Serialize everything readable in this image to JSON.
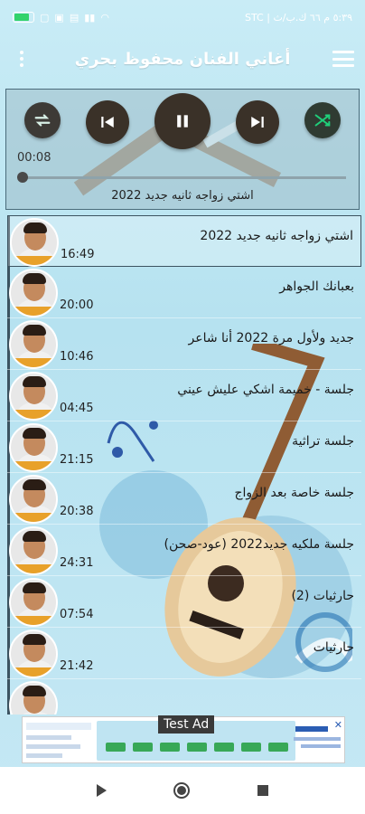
{
  "status_bar": {
    "battery_level": "",
    "right_text": "STC | ٥:٣٩ م ٦٦ ك.ب/ث"
  },
  "app_bar": {
    "title": "أغاني الفنان محفوظ بحري"
  },
  "player": {
    "current_time": "00:08",
    "now_playing": "اشتي زواجه ثانيه جديد 2022",
    "progress_fraction": 0.01,
    "state": "playing"
  },
  "songs": [
    {
      "title": "اشتي زواجه ثانيه جديد 2022",
      "duration": "16:49",
      "active": true
    },
    {
      "title": "بعبانك الجواهر",
      "duration": "20:00",
      "active": false
    },
    {
      "title": "جديد ولأول مرة 2022 أنا شاعر",
      "duration": "10:46",
      "active": false
    },
    {
      "title": "جلسة - خميمة اشكي عليش عيني",
      "duration": "04:45",
      "active": false
    },
    {
      "title": "جلسة تراثية",
      "duration": "21:15",
      "active": false
    },
    {
      "title": "جلسة خاصة بعد الزواج",
      "duration": "20:38",
      "active": false
    },
    {
      "title": "جلسة ملكيه جديد2022 (عود-صحن)",
      "duration": "24:31",
      "active": false
    },
    {
      "title": "حارثيات (2)",
      "duration": "07:54",
      "active": false
    },
    {
      "title": "حارثيات",
      "duration": "21:42",
      "active": false
    },
    {
      "title": "",
      "duration": "",
      "active": false
    }
  ],
  "ad": {
    "label": "Test Ad"
  },
  "colors": {
    "background": "#bfe6f2",
    "player_buttons": "#3a3128",
    "battery_green": "#33d36b"
  }
}
